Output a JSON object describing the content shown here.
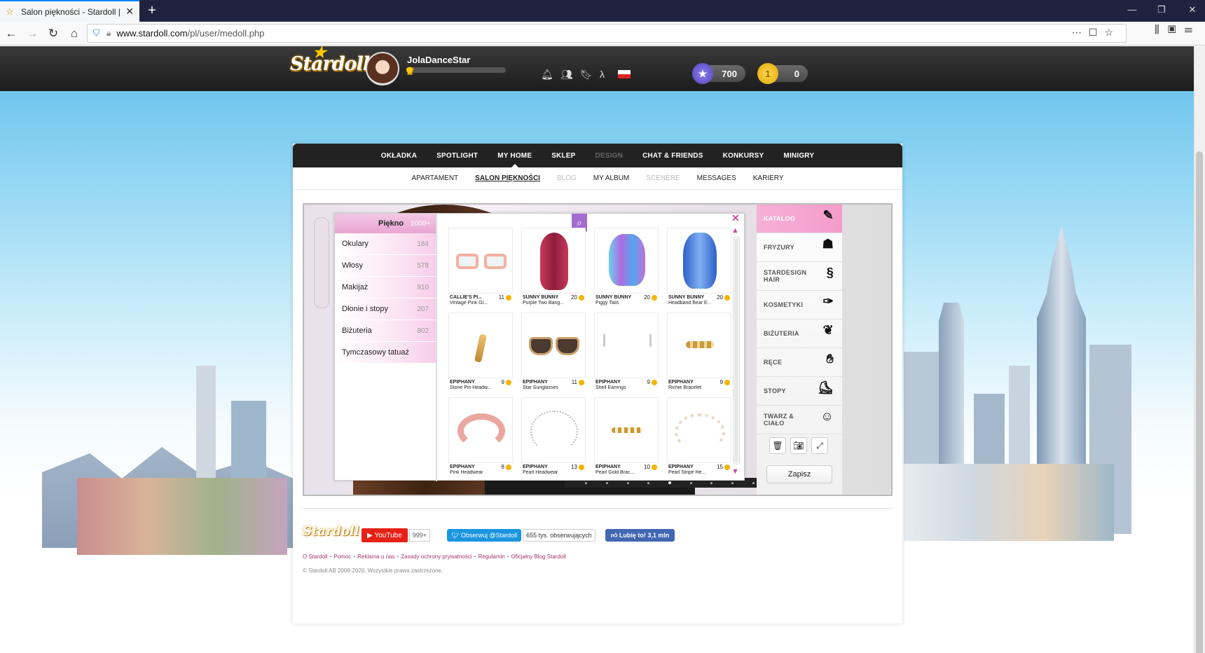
{
  "browser": {
    "tab_title": "Salon piękności - Stardoll | Pol",
    "url_host": "www.stardoll.com",
    "url_path": "/pl/user/medoll.php"
  },
  "header": {
    "logo_text": "Stardoll",
    "username": "JolaDanceStar",
    "stardollars": "700",
    "coins": "0",
    "level_progress": 0.06,
    "colors": {
      "accent_pink": "#f49ccc",
      "coin": "#f2b500",
      "stardollar": "#6a5ad8"
    }
  },
  "main_nav": [
    {
      "label": "OKŁADKA",
      "state": "normal"
    },
    {
      "label": "SPOTLIGHT",
      "state": "normal"
    },
    {
      "label": "MY HOME",
      "state": "active"
    },
    {
      "label": "SKLEP",
      "state": "normal"
    },
    {
      "label": "DESIGN",
      "state": "disabled"
    },
    {
      "label": "CHAT & FRIENDS",
      "state": "normal"
    },
    {
      "label": "KONKURSY",
      "state": "normal"
    },
    {
      "label": "MINIGRY",
      "state": "normal"
    }
  ],
  "sub_nav": [
    {
      "label": "APARTAMENT",
      "state": "normal"
    },
    {
      "label": "SALON PIĘKNOŚCI",
      "state": "active"
    },
    {
      "label": "BLOG",
      "state": "disabled"
    },
    {
      "label": "MY ALBUM",
      "state": "normal"
    },
    {
      "label": "SCENERE",
      "state": "disabled"
    },
    {
      "label": "MESSAGES",
      "state": "normal"
    },
    {
      "label": "KARIERY",
      "state": "normal"
    }
  ],
  "catalog": {
    "header_label": "Piękno",
    "header_count": "1000+",
    "categories": [
      {
        "label": "Okulary",
        "count": "184"
      },
      {
        "label": "Włosy",
        "count": "578"
      },
      {
        "label": "Makijaż",
        "count": "910"
      },
      {
        "label": "Dłonie i stopy",
        "count": "207"
      },
      {
        "label": "Biżuteria",
        "count": "802"
      },
      {
        "label": "Tymczasowy tatuaż",
        "count": ""
      }
    ],
    "items": [
      {
        "brand": "CALLIE'S PI...",
        "name": "Vintage Pink Gl...",
        "price": "11",
        "kind": "glasses"
      },
      {
        "brand": "SUNNY BUNNY",
        "name": "Purple Two Bang...",
        "price": "20",
        "kind": "hair-pink"
      },
      {
        "brand": "SUNNY BUNNY",
        "name": "Piggy Tails",
        "price": "20",
        "kind": "hair-pigtails"
      },
      {
        "brand": "SUNNY BUNNY",
        "name": "Headband Bear E...",
        "price": "20",
        "kind": "hair-blue"
      },
      {
        "brand": "EPIPHANY",
        "name": "Stone Pin Headw...",
        "price": "9",
        "kind": "pin"
      },
      {
        "brand": "EPIPHANY",
        "name": "Star Sunglasses",
        "price": "11",
        "kind": "sunglasses"
      },
      {
        "brand": "EPIPHANY",
        "name": "Shell Earrings",
        "price": "9",
        "kind": "earrings"
      },
      {
        "brand": "EPIPHANY",
        "name": "Richie Bracelet",
        "price": "9",
        "kind": "bracelet"
      },
      {
        "brand": "EPIPHANY",
        "name": "Pink Headwear",
        "price": "8",
        "kind": "headband"
      },
      {
        "brand": "EPIPHANY",
        "name": "Pearl Headwear",
        "price": "13",
        "kind": "pearl-head"
      },
      {
        "brand": "EPIPHANY",
        "name": "Pearl Gold Brac...",
        "price": "10",
        "kind": "gold-bracelet"
      },
      {
        "brand": "EPIPHANY",
        "name": "Pearl Stripe He...",
        "price": "15",
        "kind": "pearl-band"
      }
    ]
  },
  "sidebar_tabs": [
    {
      "label": "KATALOG",
      "icon": "catalog-icon",
      "active": true
    },
    {
      "label": "FRYZURY",
      "icon": "hair-icon",
      "active": false
    },
    {
      "label": "STARDESIGN HAIR",
      "icon": "seahorse-icon",
      "active": false
    },
    {
      "label": "KOSMETYKI",
      "icon": "cosmetics-icon",
      "active": false
    },
    {
      "label": "BIŻUTERIA",
      "icon": "jewelry-icon",
      "active": false
    },
    {
      "label": "RĘCE",
      "icon": "hand-icon",
      "active": false
    },
    {
      "label": "STOPY",
      "icon": "foot-icon",
      "active": false
    },
    {
      "label": "TWARZ & CIAŁO",
      "icon": "face-body-icon",
      "active": false
    }
  ],
  "save_label": "Zapisz",
  "footer": {
    "youtube_label": "YouTube",
    "youtube_count": "999+",
    "twitter_label": "Obserwuj @Stardoll",
    "twitter_count": "655 tys. obserwujących",
    "facebook_label": "Lubię to! 3,1 mln",
    "links": [
      "O Stardoll",
      "Pomoc",
      "Reklama u nas",
      "Zasady ochrony prywatności",
      "Regulamin",
      "Oficjalny Blog Stardoll"
    ],
    "copyright": "© Stardoll AB 2006-2020. Wszystkie prawa zastrzeżone."
  }
}
